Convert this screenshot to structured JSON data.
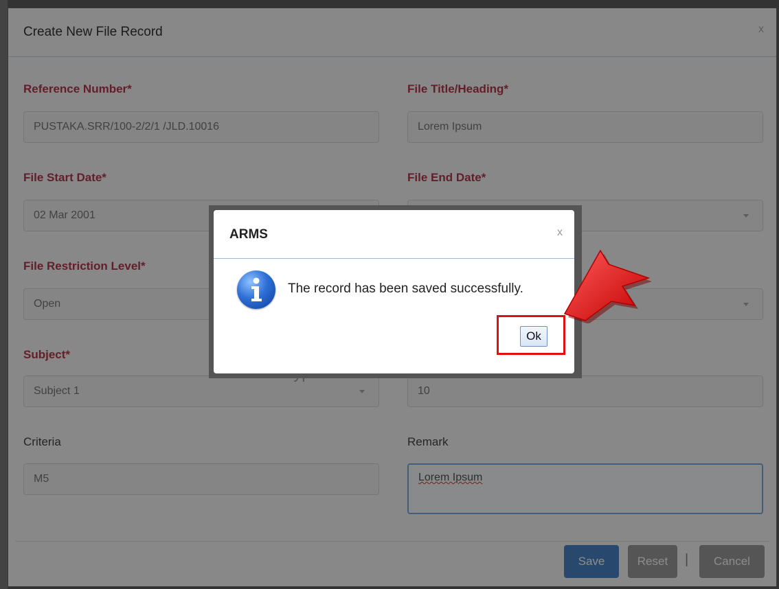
{
  "modal": {
    "title": "Create New File Record",
    "close": "x"
  },
  "form": {
    "reference_label": "Reference Number*",
    "reference_value": "PUSTAKA.SRR/100-2/2/1 /JLD.10016",
    "title_label": "File Title/Heading*",
    "title_value": "Lorem Ipsum",
    "start_label": "File Start Date*",
    "start_value": "02 Mar 2001",
    "end_label": "File End Date*",
    "end_value": "",
    "restriction_label": "File Restriction Level*",
    "restriction_value": "Open",
    "restriction_right_value": "",
    "subject_label": "Subject*",
    "subject_value": "Subject 1",
    "file_type_hidden": "File Type",
    "number_value": "10",
    "criteria_label": "Criteria",
    "criteria_value": "M5",
    "remark_label": "Remark",
    "remark_value": "Lorem Ipsum"
  },
  "footer": {
    "save": "Save",
    "reset": "Reset",
    "separator": "|",
    "cancel": "Cancel"
  },
  "alert": {
    "title": "ARMS",
    "close": "x",
    "message": "The record has been saved successfully.",
    "ok": "Ok",
    "icon": "info-icon"
  },
  "colors": {
    "required_label": "#b7384c",
    "primary": "#4a86c6",
    "highlight": "#e01010"
  }
}
